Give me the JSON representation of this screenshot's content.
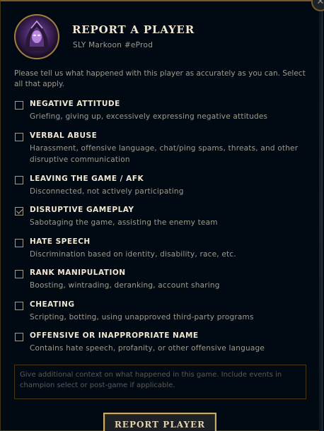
{
  "dialog": {
    "title": "REPORT A PLAYER",
    "player": "SLY Markoon #eProd",
    "close_icon": "close-icon"
  },
  "intro": "Please tell us what happened with this player as accurately as you can. Select all that apply.",
  "options": [
    {
      "title": "NEGATIVE ATTITUDE",
      "desc": "Griefing, giving up, excessively expressing negative attitudes",
      "checked": false
    },
    {
      "title": "VERBAL ABUSE",
      "desc": "Harassment, offensive language, chat/ping spams, threats, and other disruptive communication",
      "checked": false
    },
    {
      "title": "LEAVING THE GAME / AFK",
      "desc": "Disconnected, not actively participating",
      "checked": false
    },
    {
      "title": "DISRUPTIVE GAMEPLAY",
      "desc": "Sabotaging the game, assisting the enemy team",
      "checked": true
    },
    {
      "title": "HATE SPEECH",
      "desc": "Discrimination based on identity, disability, race, etc.",
      "checked": false
    },
    {
      "title": "RANK MANIPULATION",
      "desc": "Boosting, wintrading, deranking, account sharing",
      "checked": false
    },
    {
      "title": "CHEATING",
      "desc": "Scripting, botting, using unapproved third-party programs",
      "checked": false
    },
    {
      "title": "OFFENSIVE OR INAPPROPRIATE NAME",
      "desc": "Contains hate speech, profanity, or other offensive language",
      "checked": false
    }
  ],
  "context": {
    "placeholder": "Give additional context on what happened in this game. Include events in champion select or post-game if applicable."
  },
  "submit_label": "REPORT PLAYER",
  "colors": {
    "background": "#010a13",
    "gold": "#c8aa6e",
    "heading": "#f0e6d2",
    "text": "#a09b8c"
  }
}
